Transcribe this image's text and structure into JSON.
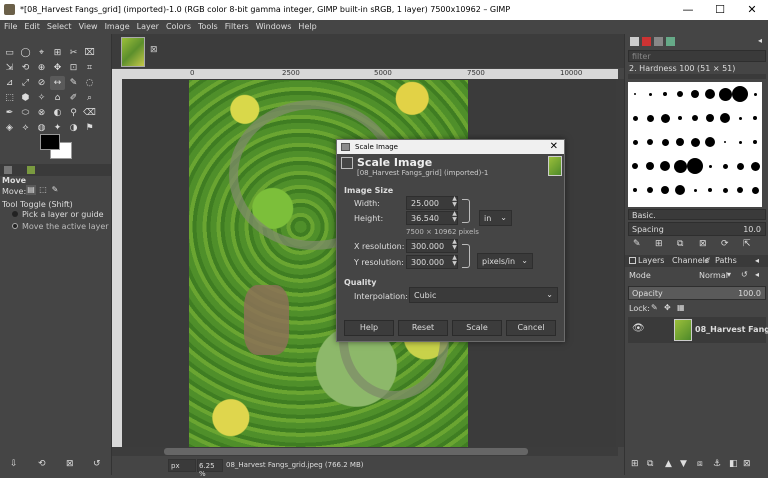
{
  "window": {
    "title": "*[08_Harvest Fangs_grid] (imported)-1.0 (RGB color 8-bit gamma integer, GIMP built-in sRGB, 1 layer) 7500x10962 – GIMP",
    "minimize": "—",
    "maximize": "☐",
    "close": "✕"
  },
  "menubar": [
    "File",
    "Edit",
    "Select",
    "View",
    "Image",
    "Layer",
    "Colors",
    "Tools",
    "Filters",
    "Windows",
    "Help"
  ],
  "toolbox": {
    "tools": [
      "▭",
      "◯",
      "⌖",
      "⊞",
      "✂",
      "⌧",
      "⇲",
      "⟲",
      "⊕",
      "✥",
      "⊡",
      "⌗",
      "⊿",
      "⤢",
      "⊘",
      "↔",
      "✎",
      "◌",
      "⬚",
      "⬢",
      "✧",
      "⌂",
      "✐",
      "⌕",
      "✒",
      "⬭",
      "⊗",
      "◐",
      "⚲",
      "⌫",
      "◈",
      "⟡",
      "◍",
      "✦",
      "◑",
      "⚑"
    ],
    "options_title": "Move",
    "move_label": "Move:",
    "tool_toggle": "Tool Toggle  (Shift)",
    "opt1": "Pick a layer or guide",
    "opt2": "Move the active layer",
    "bottom_icons": [
      "⇩",
      "⟲",
      "⊠",
      "↺"
    ]
  },
  "image_tab": {
    "close": "⊠"
  },
  "ruler": {
    "t0": "0",
    "t1": "2500",
    "t2": "5000",
    "t3": "7500",
    "t4": "10000"
  },
  "statusbar": {
    "unit": "px",
    "zoom": "6.25 %",
    "file": "08_Harvest Fangs_grid.jpeg (766.2 MB)"
  },
  "brushes_panel": {
    "filter_placeholder": "filter",
    "brush_name": "2. Hardness 100 (51 × 51)",
    "preset": "Basic.",
    "spacing_label": "Spacing",
    "spacing_value": "10.0"
  },
  "layers_panel": {
    "tabs": [
      "Layers",
      "Channels",
      "Paths"
    ],
    "mode_label": "Mode",
    "mode_value": "Normal",
    "opacity_label": "Opacity",
    "opacity_value": "100.0",
    "lock_label": "Lock:",
    "layer_name": "08_Harvest Fangs_gri"
  },
  "dialog": {
    "titlebar": "Scale Image",
    "heading": "Scale Image",
    "subtitle": "[08_Harvest Fangs_grid] (imported)-1",
    "section_size": "Image Size",
    "width_label": "Width:",
    "width_value": "25.000",
    "height_label": "Height:",
    "height_value": "36.540",
    "size_unit": "in",
    "pixels_note": "7500 × 10962 pixels",
    "xres_label": "X resolution:",
    "xres_value": "300.000",
    "yres_label": "Y resolution:",
    "yres_value": "300.000",
    "res_unit": "pixels/in",
    "section_quality": "Quality",
    "interp_label": "Interpolation:",
    "interp_value": "Cubic",
    "buttons": {
      "help": "Help",
      "reset": "Reset",
      "scale": "Scale",
      "cancel": "Cancel"
    }
  }
}
